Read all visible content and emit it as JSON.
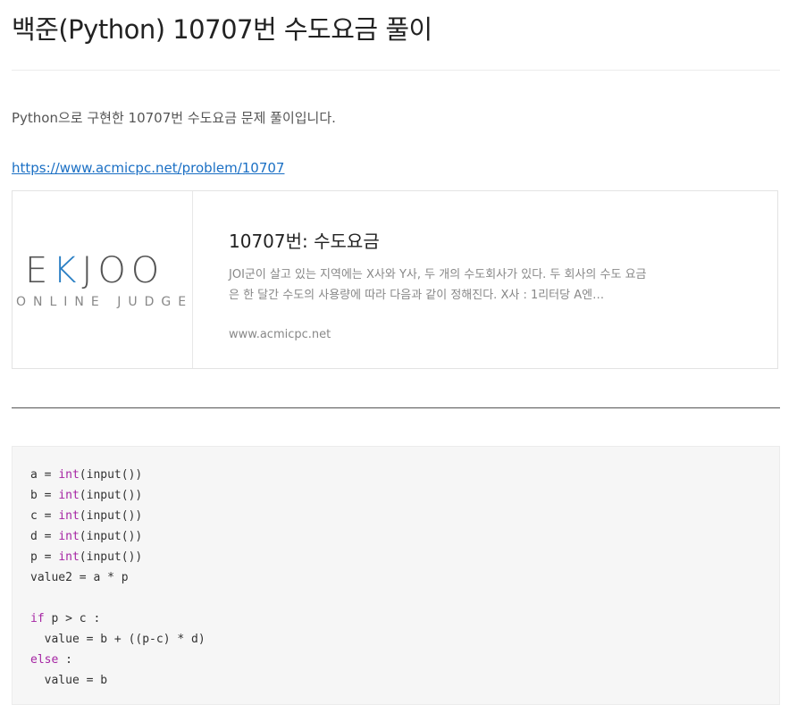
{
  "post": {
    "title": "백준(Python) 10707번 수도요금 풀이",
    "intro": "Python으로 구현한 10707번 수도요금 문제 풀이입니다.",
    "link": "https://www.acmicpc.net/problem/10707"
  },
  "og_card": {
    "logo_text": {
      "e": "E",
      "k": "K",
      "rest": "JOO"
    },
    "logo_sub": "ONLINE JUDGE",
    "title": "10707번: 수도요금",
    "description": "JOI군이 살고 있는 지역에는 X사와 Y사, 두 개의 수도회사가 있다. 두 회사의 수도 요금은 한 달간 수도의 사용량에 따라 다음과 같이 정해진다. X사 : 1리터당 A엔…",
    "domain": "www.acmicpc.net"
  },
  "code": {
    "lines": [
      [
        {
          "t": "a = "
        },
        {
          "t": "int",
          "k": 1
        },
        {
          "t": "(input())"
        }
      ],
      [
        {
          "t": "b = "
        },
        {
          "t": "int",
          "k": 1
        },
        {
          "t": "(input())"
        }
      ],
      [
        {
          "t": "c = "
        },
        {
          "t": "int",
          "k": 1
        },
        {
          "t": "(input())"
        }
      ],
      [
        {
          "t": "d = "
        },
        {
          "t": "int",
          "k": 1
        },
        {
          "t": "(input())"
        }
      ],
      [
        {
          "t": "p = "
        },
        {
          "t": "int",
          "k": 1
        },
        {
          "t": "(input())"
        }
      ],
      [
        {
          "t": "value2 = a * p"
        }
      ],
      [
        {
          "t": ""
        }
      ],
      [
        {
          "t": "if",
          "k": 1
        },
        {
          "t": " p > c :"
        }
      ],
      [
        {
          "t": "  value = b + ((p-c) * d)"
        }
      ],
      [
        {
          "t": "else",
          "k": 1
        },
        {
          "t": " :"
        }
      ],
      [
        {
          "t": "  value = b"
        }
      ]
    ]
  }
}
